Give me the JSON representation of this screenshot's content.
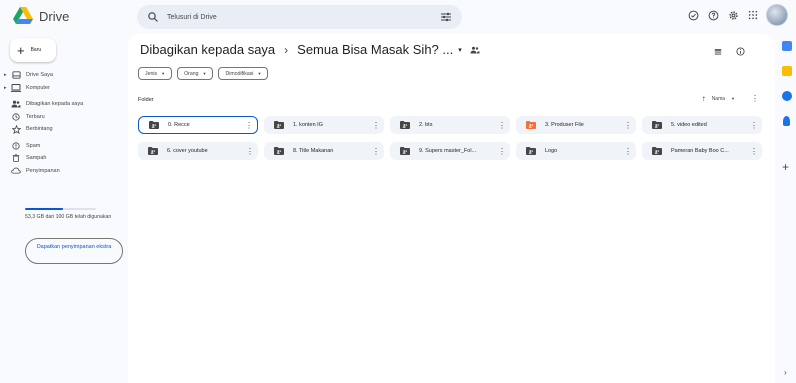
{
  "app": {
    "name": "Drive"
  },
  "search": {
    "placeholder": "Telusuri di Drive"
  },
  "sidebar": {
    "new_label": "Baru",
    "items": [
      {
        "label": "Drive Saya",
        "icon": "my-drive-icon",
        "caret": true
      },
      {
        "label": "Komputer",
        "icon": "computer-icon",
        "caret": true
      },
      {
        "label": "Dibagikan kepada saya",
        "icon": "shared-icon",
        "caret": false
      },
      {
        "label": "Terbaru",
        "icon": "recent-icon",
        "caret": false
      },
      {
        "label": "Berbintang",
        "icon": "star-icon",
        "caret": false
      },
      {
        "label": "Spam",
        "icon": "spam-icon",
        "caret": false
      },
      {
        "label": "Sampah",
        "icon": "trash-icon",
        "caret": false
      },
      {
        "label": "Penyimpanan",
        "icon": "storage-icon",
        "caret": false
      }
    ],
    "storage_text": "53,3 GB dari 100 GB telah digunakan",
    "storage_fraction": 0.533,
    "get_more_label": "Dapatkan penyimpanan ekstra"
  },
  "breadcrumb": {
    "root": "Dibagikan kepada saya",
    "separator": "›",
    "current": "Semua Bisa Masak Sih? ...",
    "caret": "▾"
  },
  "filters": [
    {
      "label": "Jenis"
    },
    {
      "label": "Orang"
    },
    {
      "label": "Dimodifikasi"
    }
  ],
  "section": {
    "label": "Folder"
  },
  "sort": {
    "label": "Nama"
  },
  "folders": [
    {
      "name": "0. Recce",
      "selected": true,
      "color": "#444746"
    },
    {
      "name": "1. konten IG",
      "selected": false,
      "color": "#444746"
    },
    {
      "name": "2. bts",
      "selected": false,
      "color": "#444746"
    },
    {
      "name": "3. Produser File",
      "selected": false,
      "color": "#f4703b"
    },
    {
      "name": "5. video edited",
      "selected": false,
      "color": "#444746"
    },
    {
      "name": "6. cover youtube",
      "selected": false,
      "color": "#444746"
    },
    {
      "name": "8. Title Makanan",
      "selected": false,
      "color": "#444746"
    },
    {
      "name": "9. Supers master_Fol...",
      "selected": false,
      "color": "#444746"
    },
    {
      "name": "Logo",
      "selected": false,
      "color": "#444746"
    },
    {
      "name": "Pameran Baby Boo C...",
      "selected": false,
      "color": "#444746"
    }
  ],
  "colors": {
    "accent": "#0b57d0",
    "background": "#f8fafd",
    "folder_bg": "#f0f4f9"
  },
  "rail": {
    "icons": [
      {
        "name": "calendar-icon",
        "color": "#4285f4"
      },
      {
        "name": "keep-icon",
        "color": "#fbbc04"
      },
      {
        "name": "tasks-icon",
        "color": "#1a73e8"
      },
      {
        "name": "contacts-icon",
        "color": "#1a73e8"
      }
    ]
  }
}
